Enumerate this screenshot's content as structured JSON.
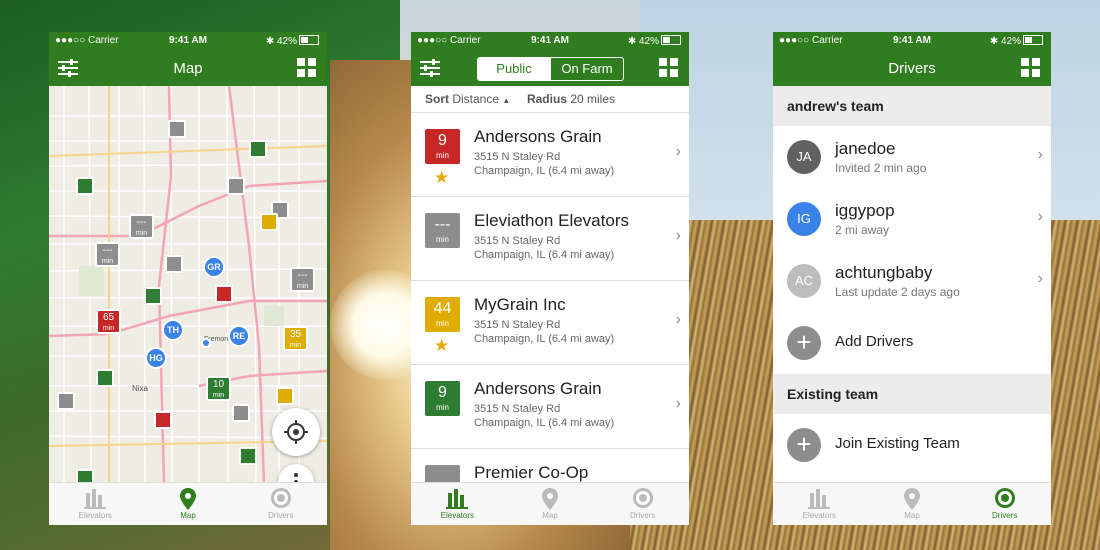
{
  "status": {
    "carrier": "●●●○○ Carrier",
    "time": "9:41 AM",
    "battery": "42%"
  },
  "map_screen": {
    "title": "Map",
    "pins": {
      "pin_65": {
        "num": "65",
        "unit": "min"
      },
      "pin_35": {
        "num": "35",
        "unit": "min"
      },
      "pin_10": {
        "num": "10",
        "unit": "min"
      },
      "pin_dash1": {
        "num": "---",
        "unit": "min"
      },
      "pin_dash2": {
        "num": "---",
        "unit": "min"
      },
      "pin_dash3": {
        "num": "---",
        "unit": "min"
      }
    },
    "drivers": {
      "gr": "GR",
      "th": "TH",
      "re": "RE",
      "hg": "HG"
    },
    "labels": {
      "nixa": "Nixa",
      "fremont": "Fremont Hills"
    }
  },
  "elevators_screen": {
    "segment_public": "Public",
    "segment_onfarm": "On Farm",
    "sort_label": "Sort",
    "sort_value": "Distance",
    "radius_label": "Radius",
    "radius_value": "20 miles",
    "rows": [
      {
        "num": "9",
        "unit": "min",
        "name": "Andersons Grain",
        "address": "3515 N Staley Rd",
        "city": "Champaign, IL  (6.4 mi away)",
        "color": "#c62828",
        "star": true
      },
      {
        "num": "---",
        "unit": "min",
        "name": "Eleviathon Elevators",
        "address": "3515 N Staley Rd",
        "city": "Champaign, IL  (6.4 mi away)",
        "color": "#8d8d8d",
        "star": false
      },
      {
        "num": "44",
        "unit": "min",
        "name": "MyGrain Inc",
        "address": "3515 N Staley Rd",
        "city": "Champaign, IL  (6.4 mi away)",
        "color": "#e0ac00",
        "star": true
      },
      {
        "num": "9",
        "unit": "min",
        "name": "Andersons Grain",
        "address": "3515 N Staley Rd",
        "city": "Champaign, IL  (6.4 mi away)",
        "color": "#2e7d32",
        "star": false
      },
      {
        "num": "",
        "unit": "",
        "name": "Premier Co-Op",
        "address": "",
        "city": "",
        "color": "#8d8d8d",
        "star": false
      }
    ]
  },
  "drivers_screen": {
    "title": "Drivers",
    "team_header": "andrew's team",
    "drivers": [
      {
        "initials": "JA",
        "name": "janedoe",
        "sub": "Invited 2 min ago",
        "color": "#616161"
      },
      {
        "initials": "IG",
        "name": "iggypop",
        "sub": "2 mi away",
        "color": "#3b82e8"
      },
      {
        "initials": "AC",
        "name": "achtungbaby",
        "sub": "Last update 2 days ago",
        "color": "#bdbdbd"
      }
    ],
    "add_drivers": "Add Drivers",
    "existing_header": "Existing team",
    "join_team": "Join Existing Team"
  },
  "tabs": {
    "elevators": "Elevators",
    "map": "Map",
    "drivers": "Drivers"
  },
  "colors": {
    "brand": "#2f7d1f",
    "accent_blue": "#3b82e8",
    "star": "#e0ac00"
  }
}
